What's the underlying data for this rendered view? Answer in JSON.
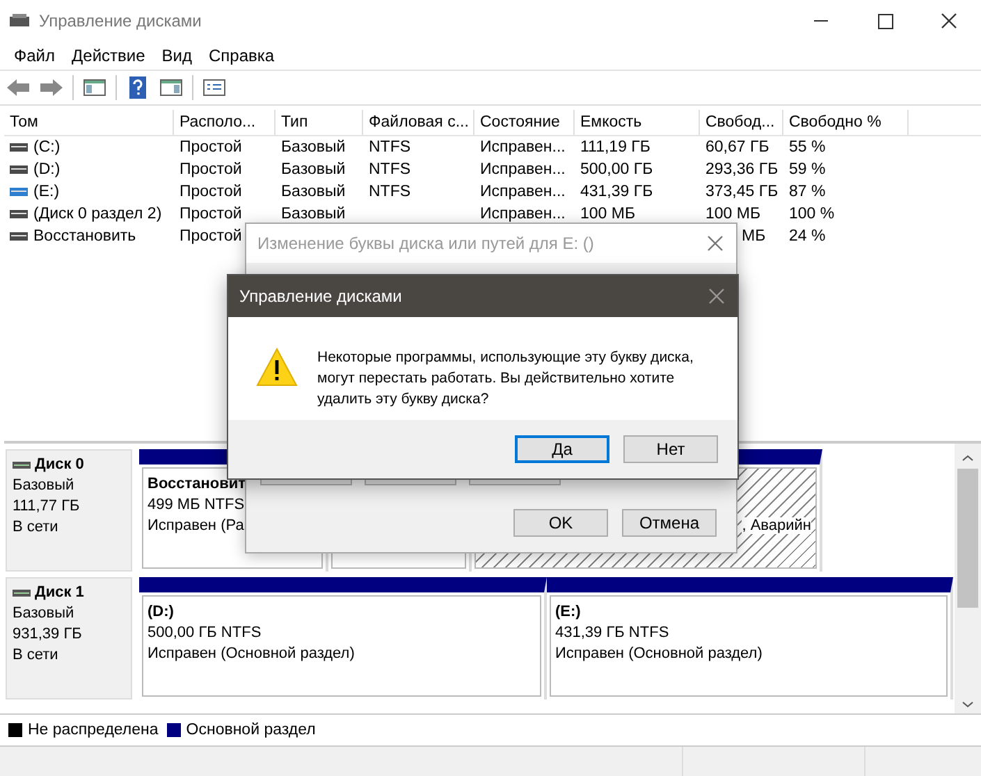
{
  "window": {
    "title": "Управление дисками"
  },
  "menu": [
    "Файл",
    "Действие",
    "Вид",
    "Справка"
  ],
  "table": {
    "columns": [
      "Том",
      "Располо...",
      "Тип",
      "Файловая с...",
      "Состояние",
      "Емкость",
      "Свобод...",
      "Свободно %"
    ],
    "rows": [
      {
        "color": "#4a4a4a",
        "cells": [
          "(C:)",
          "Простой",
          "Базовый",
          "NTFS",
          "Исправен...",
          "111,19 ГБ",
          "60,67 ГБ",
          "55 %"
        ]
      },
      {
        "color": "#4a4a4a",
        "cells": [
          "(D:)",
          "Простой",
          "Базовый",
          "NTFS",
          "Исправен...",
          "500,00 ГБ",
          "293,36 ГБ",
          "59 %"
        ]
      },
      {
        "color": "#2f7fd0",
        "cells": [
          "(E:)",
          "Простой",
          "Базовый",
          "NTFS",
          "Исправен...",
          "431,39 ГБ",
          "373,45 ГБ",
          "87 %"
        ]
      },
      {
        "color": "#4a4a4a",
        "cells": [
          "(Диск 0 раздел 2)",
          "Простой",
          "Базовый",
          null,
          "Исправен...",
          "100 МБ",
          "100 МБ",
          "100 %"
        ]
      },
      {
        "color": "#4a4a4a",
        "cells": [
          "Восстановить",
          "Простой",
          null,
          null,
          null,
          null,
          {
            "text": "МБ",
            "kind": "clipped"
          },
          "24 %"
        ]
      }
    ]
  },
  "disks": [
    {
      "name": "Диск 0",
      "type": "Базовый",
      "size": "111,77 ГБ",
      "status": "В сети",
      "partitions": [
        {
          "hatched": false,
          "lines": [
            {
              "text": "Восстановит",
              "bold": true
            },
            {
              "text": "499 МБ NTFS"
            },
            {
              "text": "Исправен (Ра"
            }
          ]
        },
        {
          "hatched": false
        },
        {
          "hatched": true,
          "kind": "clipped",
          "lines": [
            {
              "text": ", Аварийн"
            }
          ]
        }
      ]
    },
    {
      "name": "Диск 1",
      "type": "Базовый",
      "size": "931,39 ГБ",
      "status": "В сети",
      "partitions": [
        {
          "hatched": false,
          "lines": [
            {
              "text": "(D:)",
              "bold": true
            },
            {
              "text": "500,00 ГБ NTFS"
            },
            {
              "text": "Исправен (Основной раздел)"
            }
          ]
        },
        {
          "hatched": false,
          "lines": [
            {
              "text": "(E:)",
              "bold": true
            },
            {
              "text": "431,39 ГБ NTFS"
            },
            {
              "text": "Исправен (Основной раздел)"
            }
          ]
        }
      ]
    }
  ],
  "legend": [
    {
      "label": "Не распределена",
      "color": "#000000"
    },
    {
      "label": "Основной раздел",
      "color": "#000080"
    }
  ],
  "back_dialog": {
    "title": "Изменение буквы диска или путей для E: ()",
    "buttons": [
      "OK",
      "Отмена"
    ]
  },
  "dialog": {
    "title": "Управление дисками",
    "message": "Некоторые программы, использующие эту букву диска, могут перестать работать. Вы действительно хотите удалить эту букву диска?",
    "buttons": [
      {
        "label": "Да",
        "default": true
      },
      {
        "label": "Нет",
        "default": false
      }
    ]
  }
}
